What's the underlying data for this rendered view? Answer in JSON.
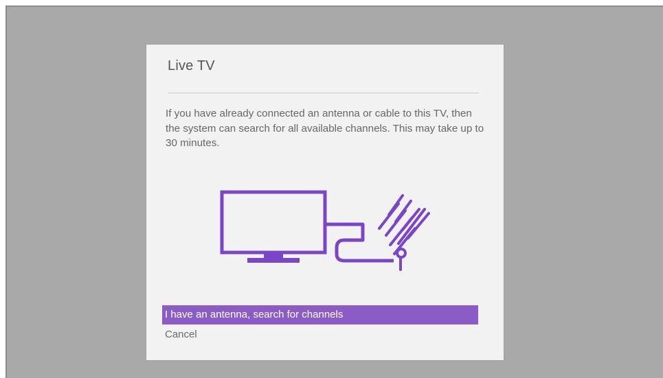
{
  "dialog": {
    "title": "Live TV",
    "message": "If you have already connected an antenna or cable to this TV, then the system can search for all available channels. This may take up to 30 minutes.",
    "illustration_icon": "tv-antenna-illustration-icon",
    "options": [
      {
        "label": "I have an antenna, search for channels",
        "selected": true
      },
      {
        "label": "Cancel",
        "selected": false
      }
    ]
  },
  "colors": {
    "accent": "#8b5cc6",
    "illustration": "#7a45c7",
    "screen_bg": "#a9a9a9",
    "dialog_bg": "#f2f2f2"
  }
}
